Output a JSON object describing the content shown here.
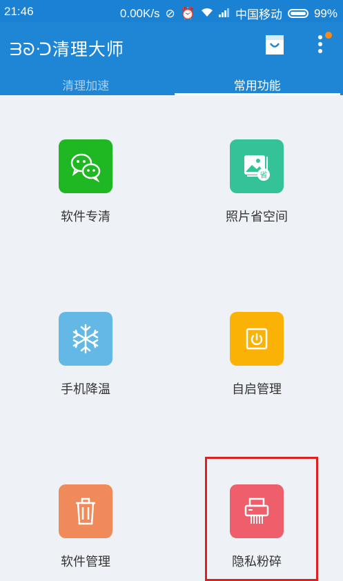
{
  "status": {
    "time": "21:46",
    "speed": "0.00K/s",
    "carrier": "中国移动",
    "battery": "99%"
  },
  "header": {
    "brand": "ᗱᘐᑝ清理大师"
  },
  "tabs": [
    {
      "label": "清理加速",
      "active": false
    },
    {
      "label": "常用功能",
      "active": true
    }
  ],
  "features": [
    {
      "label": "软件专清",
      "icon": "wechat-icon",
      "color": "#1fb823"
    },
    {
      "label": "照片省空间",
      "icon": "photo-save-icon",
      "color": "#34c398"
    },
    {
      "label": "手机降温",
      "icon": "snowflake-icon",
      "color": "#63b8e6"
    },
    {
      "label": "自启管理",
      "icon": "power-icon",
      "color": "#fbb206"
    },
    {
      "label": "软件管理",
      "icon": "trash-icon",
      "color": "#f08a5b"
    },
    {
      "label": "隐私粉碎",
      "icon": "shredder-icon",
      "color": "#ef5e6b"
    }
  ]
}
